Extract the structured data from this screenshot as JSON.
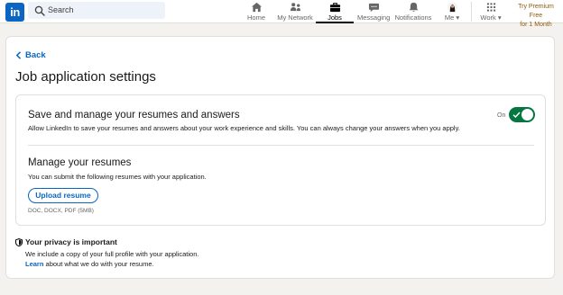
{
  "nav": {
    "logo": "in",
    "search_placeholder": "Search",
    "items": [
      {
        "label": "Home",
        "icon": "home-icon"
      },
      {
        "label": "My Network",
        "icon": "network-icon"
      },
      {
        "label": "Jobs",
        "icon": "briefcase-icon",
        "active": true
      },
      {
        "label": "Messaging",
        "icon": "messaging-icon"
      },
      {
        "label": "Notifications",
        "icon": "bell-icon"
      },
      {
        "label": "Me",
        "icon": "avatar"
      },
      {
        "label": "Work",
        "icon": "grid-icon"
      }
    ],
    "premium_line1": "Try Premium Free",
    "premium_line2": "for 1 Month"
  },
  "page": {
    "back": "Back",
    "title": "Job application settings"
  },
  "resumes_answers": {
    "title": "Save and manage your resumes and answers",
    "description": "Allow LinkedIn to save your resumes and answers about your work experience and skills. You can always change your answers when you apply.",
    "toggle_label": "On",
    "toggle_on": true
  },
  "manage": {
    "title": "Manage your resumes",
    "description": "You can submit the following resumes with your application.",
    "upload_label": "Upload resume",
    "formats": "DOC, DOCX, PDF (5MB)"
  },
  "privacy": {
    "title": "Your privacy is important",
    "text": "We include a copy of your full profile with your application.",
    "link": "Learn",
    "link_rest": " about what we do with your resume."
  },
  "colors": {
    "brand": "#0a66c2",
    "toggle_on": "#057642",
    "premium": "#915907"
  }
}
